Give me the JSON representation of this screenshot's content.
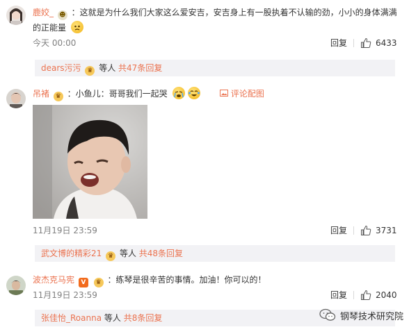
{
  "comments": [
    {
      "username": "鹿姣_",
      "text": "：这就是为什么我们大家这么爱安吉，安吉身上有一股执着不认输的劲，小小的身体满满",
      "text_cont": "的正能量",
      "time": "今天 00:00",
      "reply_label": "回复",
      "likes": "6433",
      "reply_preview": {
        "name": "dears污污",
        "suffix": "等人",
        "count": "共47条回复"
      }
    },
    {
      "username": "吊褚",
      "text": "：小鱼儿：哥哥我们一起哭",
      "image_action": "评论配图",
      "time": "11月19日 23:59",
      "reply_label": "回复",
      "likes": "3731",
      "reply_preview": {
        "name": "武文博的精彩21",
        "suffix": "等人",
        "count": "共48条回复"
      }
    },
    {
      "username": "波杰克马宪",
      "text": "：练琴是很辛苦的事情。加油！你可以的！",
      "time": "11月19日 23:59",
      "reply_label": "回复",
      "likes": "2040",
      "reply_preview": {
        "name": "张佳怡_Roanna",
        "suffix": "等人",
        "count": "共8条回复"
      }
    }
  ],
  "watermark": "钢琴技术研究院",
  "colors": {
    "username": "#eb7350",
    "reply_bg": "#f2f2f5",
    "meta": "#808080"
  }
}
